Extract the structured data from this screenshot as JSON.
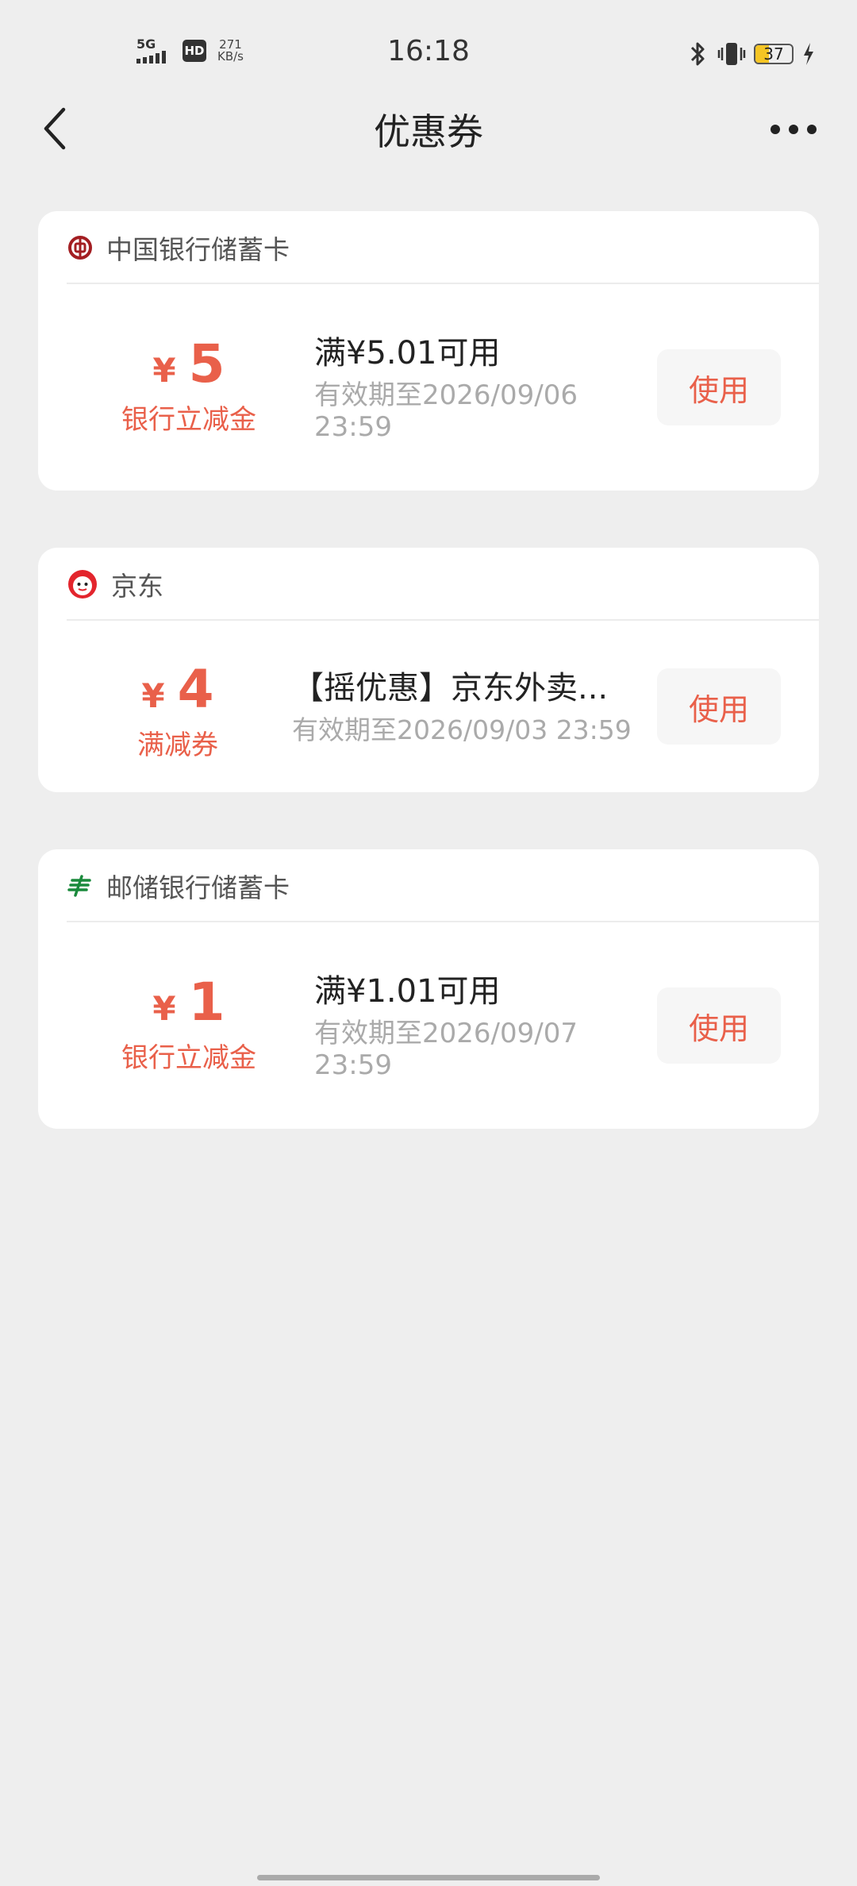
{
  "status_bar": {
    "time": "16:18",
    "signal_label": "5G",
    "hd_label": "HD",
    "net_speed_value": "271",
    "net_speed_unit": "KB/s",
    "battery_level": "37",
    "battery_fill_percent": 37
  },
  "nav": {
    "title": "优惠券"
  },
  "colors": {
    "accent": "#e9604a",
    "boc_red": "#a31e22",
    "jd_red": "#e3252d",
    "psbc_green": "#1a8a3c"
  },
  "coupons": [
    {
      "issuer": "中国银行储蓄卡",
      "issuer_icon": "boc-logo-icon",
      "currency": "¥",
      "amount": "5",
      "type": "银行立减金",
      "title": "满¥5.01可用",
      "expiry": "有效期至2026/09/06 23:59",
      "button": "使用"
    },
    {
      "issuer": "京东",
      "issuer_icon": "jd-logo-icon",
      "currency": "¥",
      "amount": "4",
      "type": "满减券",
      "title": "【摇优惠】京东外卖...",
      "expiry": "有效期至2026/09/03 23:59",
      "button": "使用"
    },
    {
      "issuer": "邮储银行储蓄卡",
      "issuer_icon": "psbc-logo-icon",
      "currency": "¥",
      "amount": "1",
      "type": "银行立减金",
      "title": "满¥1.01可用",
      "expiry": "有效期至2026/09/07 23:59",
      "button": "使用"
    }
  ]
}
